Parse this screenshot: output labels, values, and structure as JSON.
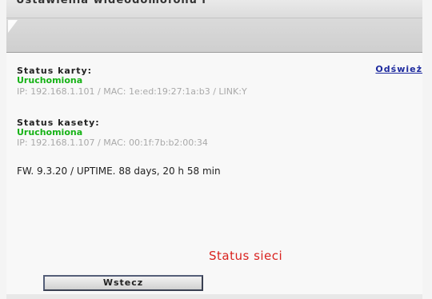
{
  "header": {
    "title": "Ustawienia wideodomofonu i"
  },
  "card": {
    "label": "Status karty:",
    "state": "Uruchomiona",
    "details": "IP: 192.168.1.101 / MAC: 1e:ed:19:27:1a:b3 / LINK:Y"
  },
  "refresh": {
    "label": "Odśwież"
  },
  "cassette": {
    "label": "Status kasety:",
    "state": "Uruchomiona",
    "details": "IP: 192.168.1.107 / MAC: 00:1f:7b:b2:00:34"
  },
  "firmware": {
    "line": "FW. 9.3.20 / UPTIME. 88 days, 20 h 58 min"
  },
  "network": {
    "title": "Status sieci"
  },
  "buttons": {
    "back_label": "Wstecz"
  },
  "colors": {
    "status_ok": "#16b316",
    "link": "#1d2a9e",
    "network_title": "#d9221f"
  }
}
